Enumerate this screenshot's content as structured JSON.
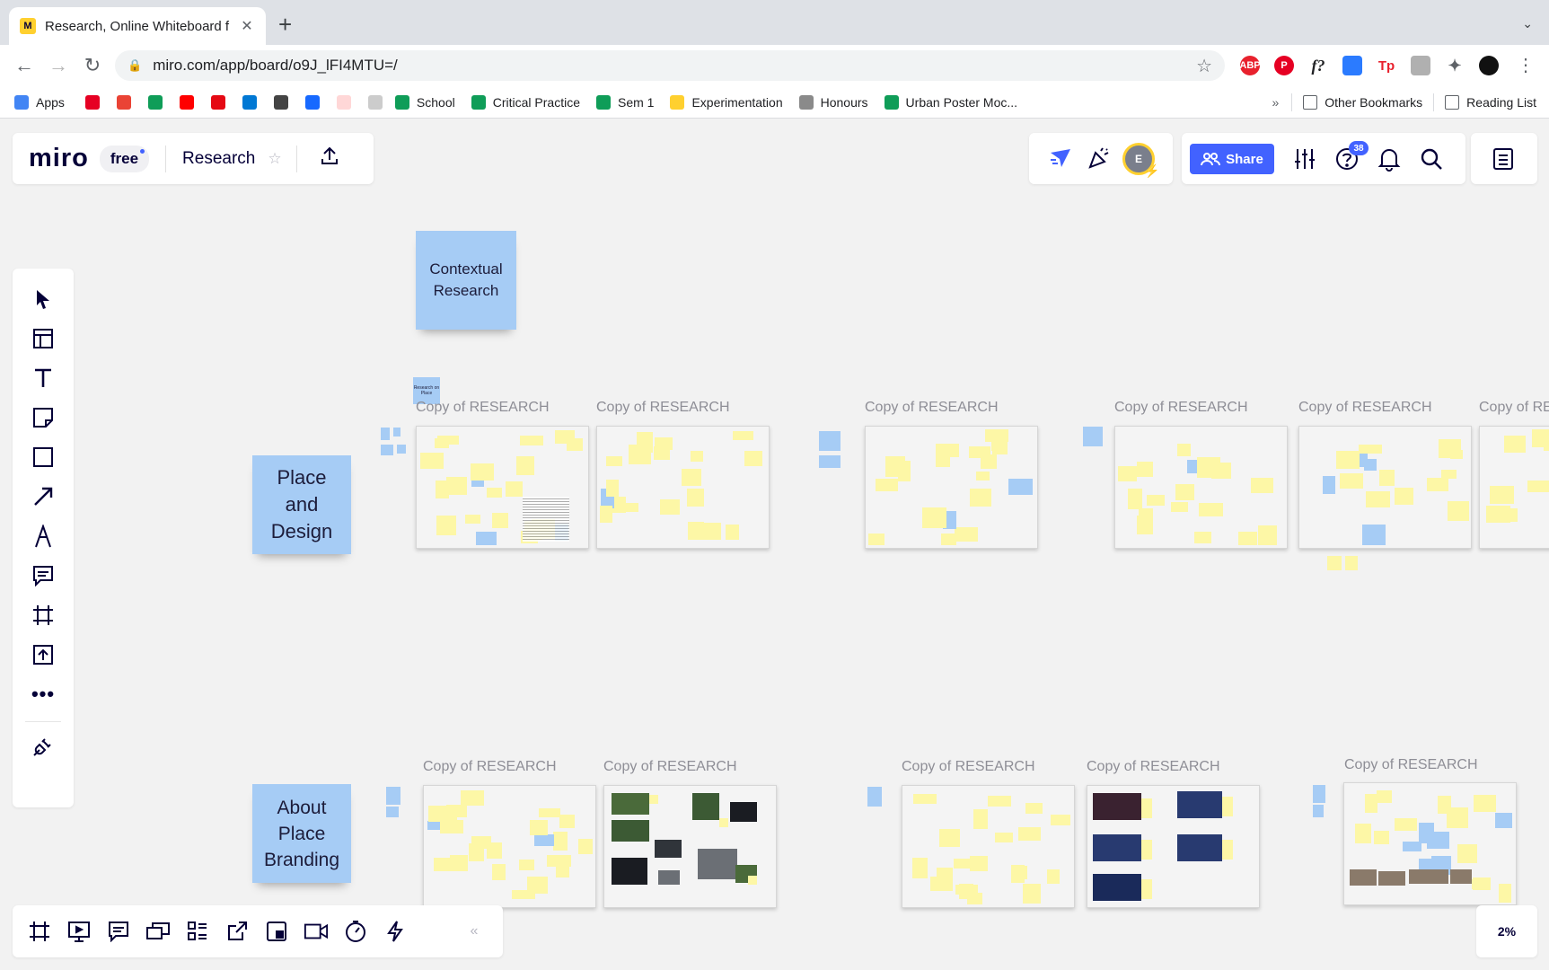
{
  "browser": {
    "tab_title": "Research, Online Whiteboard f",
    "url": "miro.com/app/board/o9J_lFI4MTU=/",
    "bookmarks": [
      {
        "label": "Apps",
        "color": "#4285f4"
      },
      {
        "label": "",
        "color": "#e60023"
      },
      {
        "label": "",
        "color": "#ea4335"
      },
      {
        "label": "",
        "color": "#0f9d58"
      },
      {
        "label": "",
        "color": "#ff0000"
      },
      {
        "label": "",
        "color": "#e50914"
      },
      {
        "label": "",
        "color": "#0078d4"
      },
      {
        "label": "",
        "color": "#444444"
      },
      {
        "label": "",
        "color": "#1769ff"
      },
      {
        "label": "",
        "color": "#ffd7d7"
      },
      {
        "label": "",
        "color": "#cccccc"
      },
      {
        "label": "School",
        "color": "#0f9d58"
      },
      {
        "label": "Critical Practice",
        "color": "#0f9d58"
      },
      {
        "label": "Sem 1",
        "color": "#0f9d58"
      },
      {
        "label": "Experimentation",
        "color": "#ffd02f"
      },
      {
        "label": "Honours",
        "color": "#8a8a8a"
      },
      {
        "label": "Urban Poster Moc...",
        "color": "#0f9d58"
      }
    ],
    "overflow": "»",
    "other_bookmarks": "Other Bookmarks",
    "reading_list": "Reading List",
    "extensions": [
      {
        "name": "adblock-icon",
        "label": "ABP",
        "color": "#e8212d"
      },
      {
        "name": "pinterest-icon",
        "label": "P",
        "color": "#e60023"
      },
      {
        "name": "fontface-icon",
        "label": "f?",
        "color": "#ffffff"
      },
      {
        "name": "colorpick-icon",
        "label": "",
        "color": "#2b7bff"
      },
      {
        "name": "tp-icon",
        "label": "Tp",
        "color": "#ffffff"
      },
      {
        "name": "ext-grey-icon",
        "label": "",
        "color": "#b0b0b0"
      },
      {
        "name": "puzzle-icon",
        "label": "",
        "color": "#ffffff"
      },
      {
        "name": "profile-icon",
        "label": "",
        "color": "#111111"
      }
    ]
  },
  "miro": {
    "logo": "miro",
    "plan": "free",
    "board_name": "Research",
    "share_label": "Share",
    "avatar_initial": "E",
    "notifications_count": "38",
    "zoom": "2%",
    "collapse": "«"
  },
  "board": {
    "sticky_contextual": "Contextual Research",
    "sticky_place": "Place and Design",
    "sticky_about": "About Place Branding",
    "mini_sticky": "Research on Place",
    "frame_label": "Copy of RESEARCH",
    "frame_label_cut": "Copy of RE"
  },
  "colors": {
    "accent": "#4262ff",
    "sticky_blue": "#a6ccf5",
    "sticky_yellow": "#fdf7a6"
  }
}
